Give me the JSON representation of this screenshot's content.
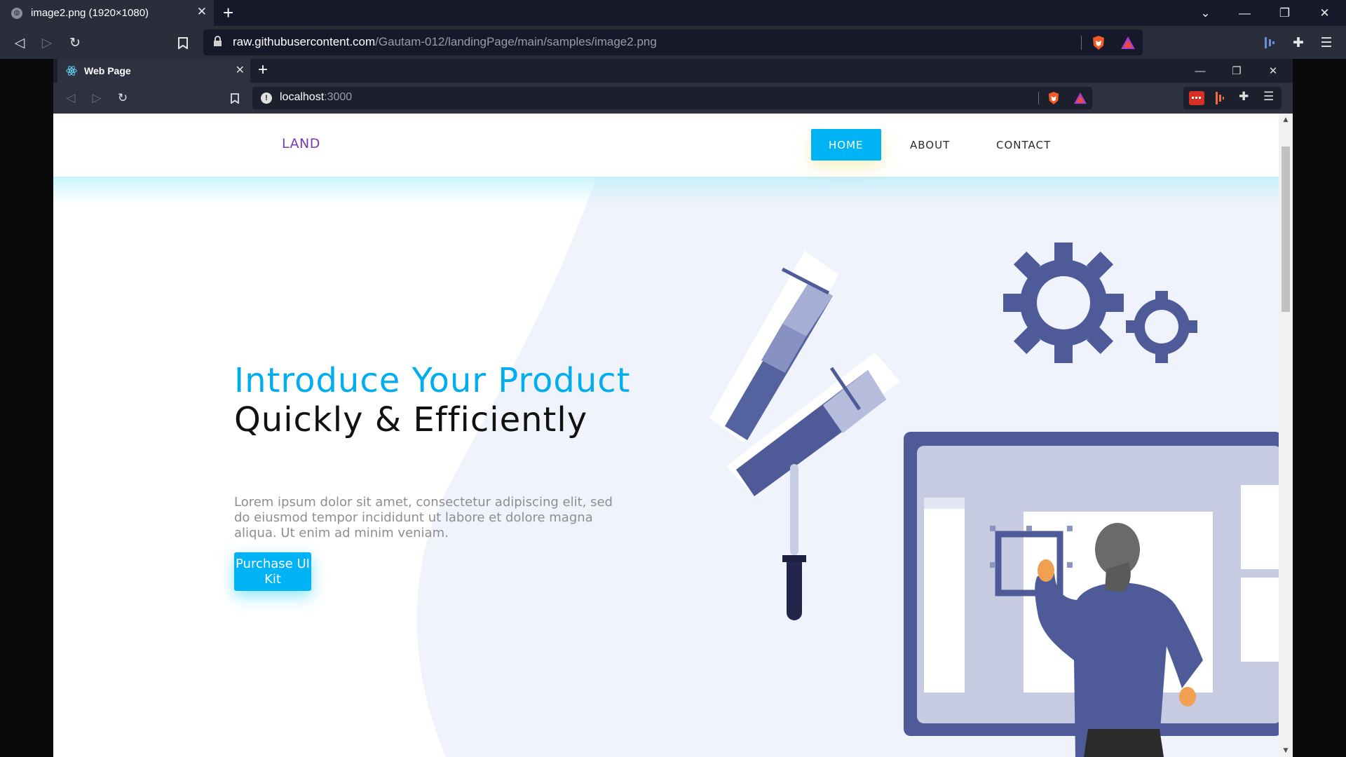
{
  "outer_browser": {
    "tab_title": "image2.png (1920×1080)",
    "url_host": "raw.githubusercontent.com",
    "url_path": "/Gautam-012/landingPage/main/samples/image2.png"
  },
  "inner_browser": {
    "tab_title": "Web Page",
    "url_host": "localhost",
    "url_port": ":3000"
  },
  "site": {
    "logo": "LAND",
    "nav": [
      {
        "label": "HOME",
        "active": true
      },
      {
        "label": "ABOUT",
        "active": false
      },
      {
        "label": "CONTACT",
        "active": false
      }
    ],
    "hero": {
      "title_accent": "Introduce Your Product",
      "title_rest": " Quickly & Efficiently",
      "text": "Lorem ipsum dolor sit amet, consectetur adipiscing elit, sed do eiusmod tempor incididunt ut labore et dolore magna aliqua. Ut enim ad minim veniam.",
      "cta_label": "Purchase UI Kit"
    }
  },
  "colors": {
    "accent": "#00b3f5",
    "logo": "#7c3ab0",
    "illustration": "#4f5b99"
  }
}
